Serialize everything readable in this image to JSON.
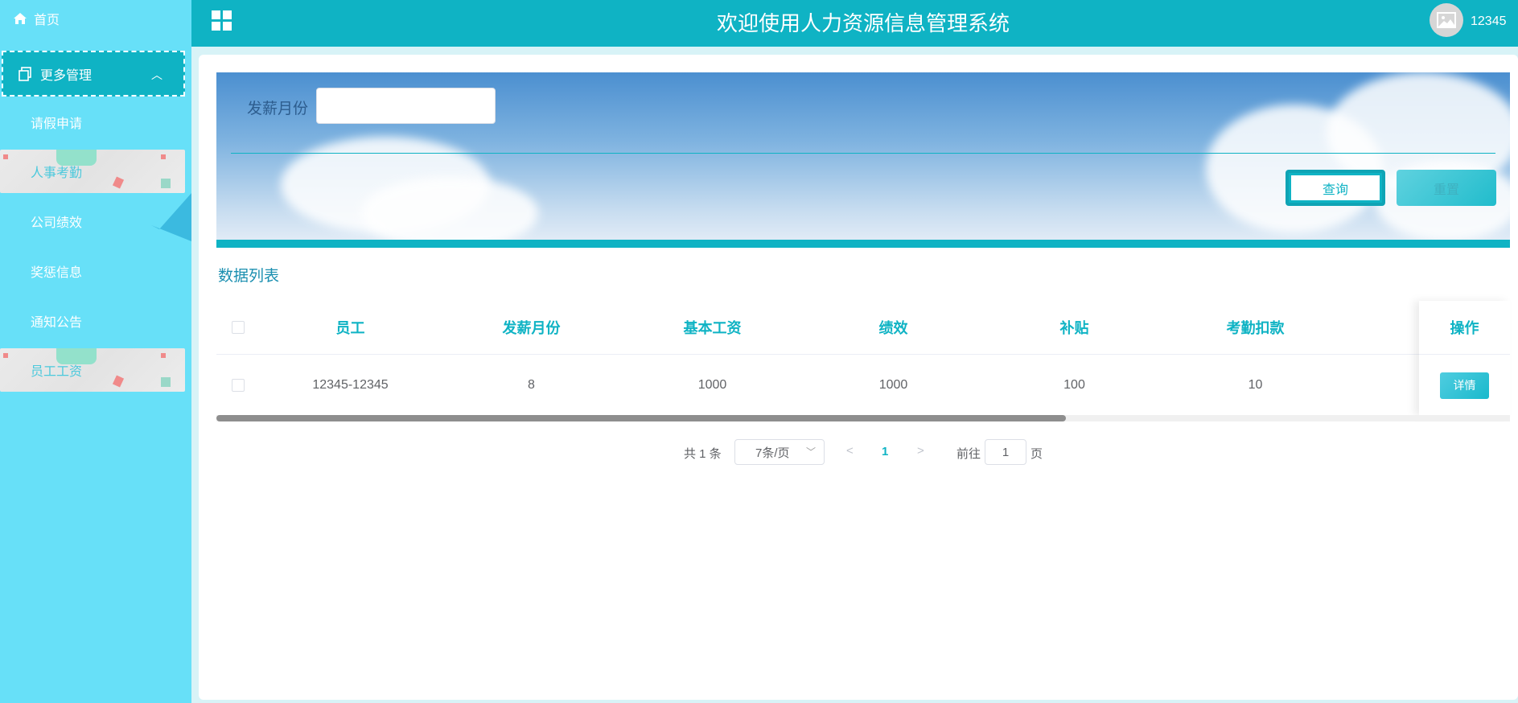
{
  "header": {
    "title": "欢迎使用人力资源信息管理系统",
    "username": "12345"
  },
  "sidebar": {
    "home": "首页",
    "group": "更多管理",
    "items": [
      {
        "label": "请假申请",
        "active": false
      },
      {
        "label": "人事考勤",
        "active": true
      },
      {
        "label": "公司绩效",
        "active": false
      },
      {
        "label": "奖惩信息",
        "active": false
      },
      {
        "label": "通知公告",
        "active": false
      },
      {
        "label": "员工工资",
        "active": true
      }
    ]
  },
  "search": {
    "label": "发薪月份",
    "value": "",
    "placeholder": "",
    "query_button": "查询",
    "reset_button": "重置"
  },
  "list": {
    "title": "数据列表",
    "columns": [
      "员工",
      "发薪月份",
      "基本工资",
      "绩效",
      "补贴",
      "考勤扣款",
      "操作"
    ],
    "rows": [
      {
        "employee": "12345-12345",
        "month": "8",
        "base": "1000",
        "performance": "1000",
        "subsidy": "100",
        "deduction": "10",
        "action": "详情"
      }
    ]
  },
  "pagination": {
    "total": "共 1 条",
    "page_size": "7条/页",
    "current": "1",
    "goto_label": "前往",
    "goto_value": "1",
    "page_unit": "页"
  }
}
